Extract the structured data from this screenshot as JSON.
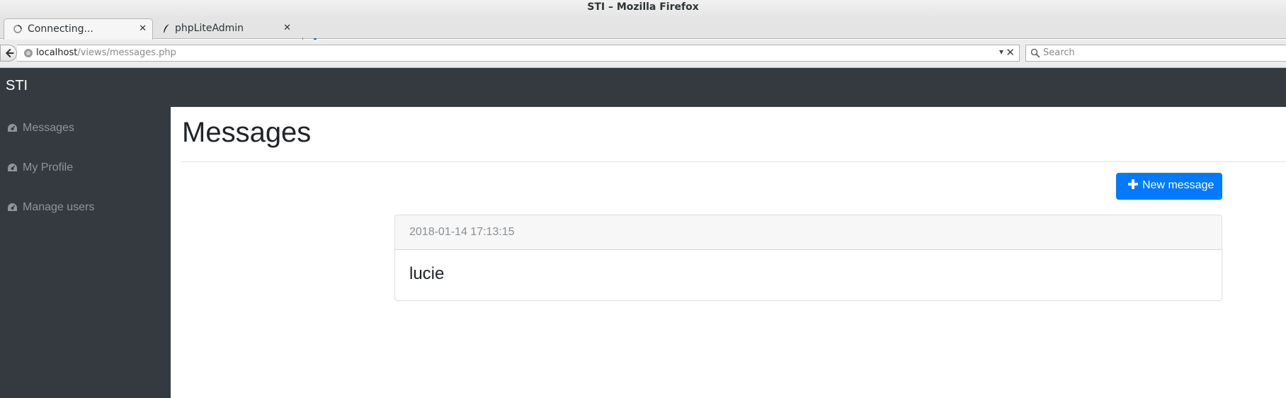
{
  "window": {
    "title": "STI – Mozilla Firefox"
  },
  "tabs": [
    {
      "label": "Connecting...",
      "icon": "loading-icon",
      "active": true
    },
    {
      "label": "phpLiteAdmin",
      "icon": "feather-icon",
      "active": false
    }
  ],
  "navbar": {
    "url_host": "localhost",
    "url_path": "/views/messages.php",
    "search_placeholder": "Search"
  },
  "app": {
    "brand": "STI",
    "sidebar": {
      "items": [
        {
          "label": "Messages",
          "icon": "dashboard-icon"
        },
        {
          "label": "My Profile",
          "icon": "dashboard-icon"
        },
        {
          "label": "Manage users",
          "icon": "dashboard-icon"
        }
      ]
    },
    "main": {
      "title": "Messages",
      "new_button_label": "New message",
      "messages": [
        {
          "date": "2018-01-14 17:13:15",
          "body": "lucie"
        }
      ]
    }
  },
  "colors": {
    "navbar_bg": "#343a40",
    "primary": "#007bff",
    "sidebar_text": "#8f959b"
  }
}
